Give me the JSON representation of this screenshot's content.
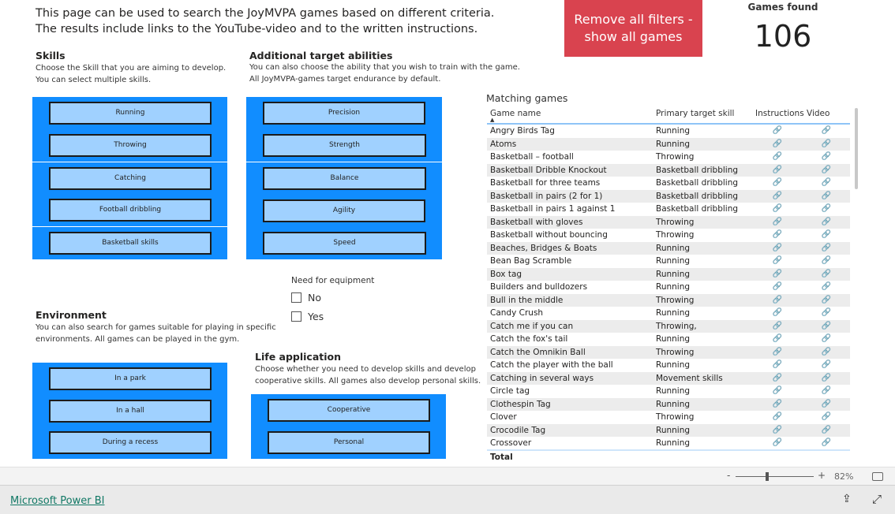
{
  "intro": {
    "line1": "This page can be used to search the JoyMVPA games based on different criteria.",
    "line2": "The results include links to the YouTube-video and to the written instructions."
  },
  "reset_button": {
    "line1": "Remove all filters -",
    "line2": "show all games"
  },
  "games_found": {
    "label": "Games found",
    "value": "106"
  },
  "skills": {
    "title": "Skills",
    "desc1": "Choose the Skill that you are aiming to develop.",
    "desc2": "You can select multiple skills.",
    "options": [
      "Running",
      "Throwing",
      "Catching",
      "Football dribbling",
      "Basketball skills"
    ]
  },
  "abilities": {
    "title": "Additional target abilities",
    "desc1": "You can also choose the ability that you wish to train with the game.",
    "desc2": "All JoyMVPA-games target endurance by default.",
    "options": [
      "Precision",
      "Strength",
      "Balance",
      "Agility",
      "Speed"
    ]
  },
  "equipment": {
    "title": "Need for equipment",
    "options": [
      "No",
      "Yes"
    ]
  },
  "environment": {
    "title": "Environment",
    "desc1": "You can also search for games suitable for playing in specific",
    "desc2": "environments. All games can be played in the gym.",
    "options": [
      "In a park",
      "In a hall",
      "During a recess"
    ]
  },
  "life": {
    "title": "Life application",
    "desc1": "Choose whether you need to develop skills and develop",
    "desc2": "cooperative skills. All games also develop personal skills.",
    "options": [
      "Cooperative",
      "Personal"
    ]
  },
  "table": {
    "title": "Matching games",
    "columns": [
      "Game name",
      "Primary target skill",
      "Instructions",
      "Video"
    ],
    "sort": "ascending",
    "link_icon": "link-icon",
    "rows": [
      [
        "Angry Birds Tag",
        "Running"
      ],
      [
        "Atoms",
        "Running"
      ],
      [
        "Basketball – football",
        "Throwing"
      ],
      [
        "Basketball Dribble Knockout",
        "Basketball dribbling"
      ],
      [
        "Basketball for three teams",
        "Basketball dribbling"
      ],
      [
        "Basketball in pairs (2 for 1)",
        "Basketball dribbling"
      ],
      [
        "Basketball in pairs 1 against 1",
        "Basketball dribbling"
      ],
      [
        "Basketball with gloves",
        "Throwing"
      ],
      [
        "Basketball without bouncing",
        "Throwing"
      ],
      [
        "Beaches, Bridges & Boats",
        "Running"
      ],
      [
        "Bean Bag Scramble",
        "Running"
      ],
      [
        "Box tag",
        "Running"
      ],
      [
        "Builders and bulldozers",
        "Running"
      ],
      [
        "Bull in the middle",
        "Throwing"
      ],
      [
        "Candy Crush",
        "Running"
      ],
      [
        "Catch me if you can",
        "Throwing,"
      ],
      [
        "Catch the fox's tail",
        "Running"
      ],
      [
        "Catch the Omnikin Ball",
        "Throwing"
      ],
      [
        "Catch the player with the ball",
        "Running"
      ],
      [
        "Catching in several ways",
        "Movement skills"
      ],
      [
        "Circle tag",
        "Running"
      ],
      [
        "Clothespin Tag",
        "Running"
      ],
      [
        "Clover",
        "Throwing"
      ],
      [
        "Crocodile Tag",
        "Running"
      ],
      [
        "Crossover",
        "Running"
      ]
    ],
    "total_label": "Total"
  },
  "zoom": {
    "minus": "-",
    "plus": "+",
    "level": "82%",
    "level_fraction": 0.4
  },
  "footer": {
    "link": "Microsoft Power BI"
  },
  "colors": {
    "panel": "#118dff",
    "button": "#a0d1ff",
    "reset": "#d9434f"
  }
}
